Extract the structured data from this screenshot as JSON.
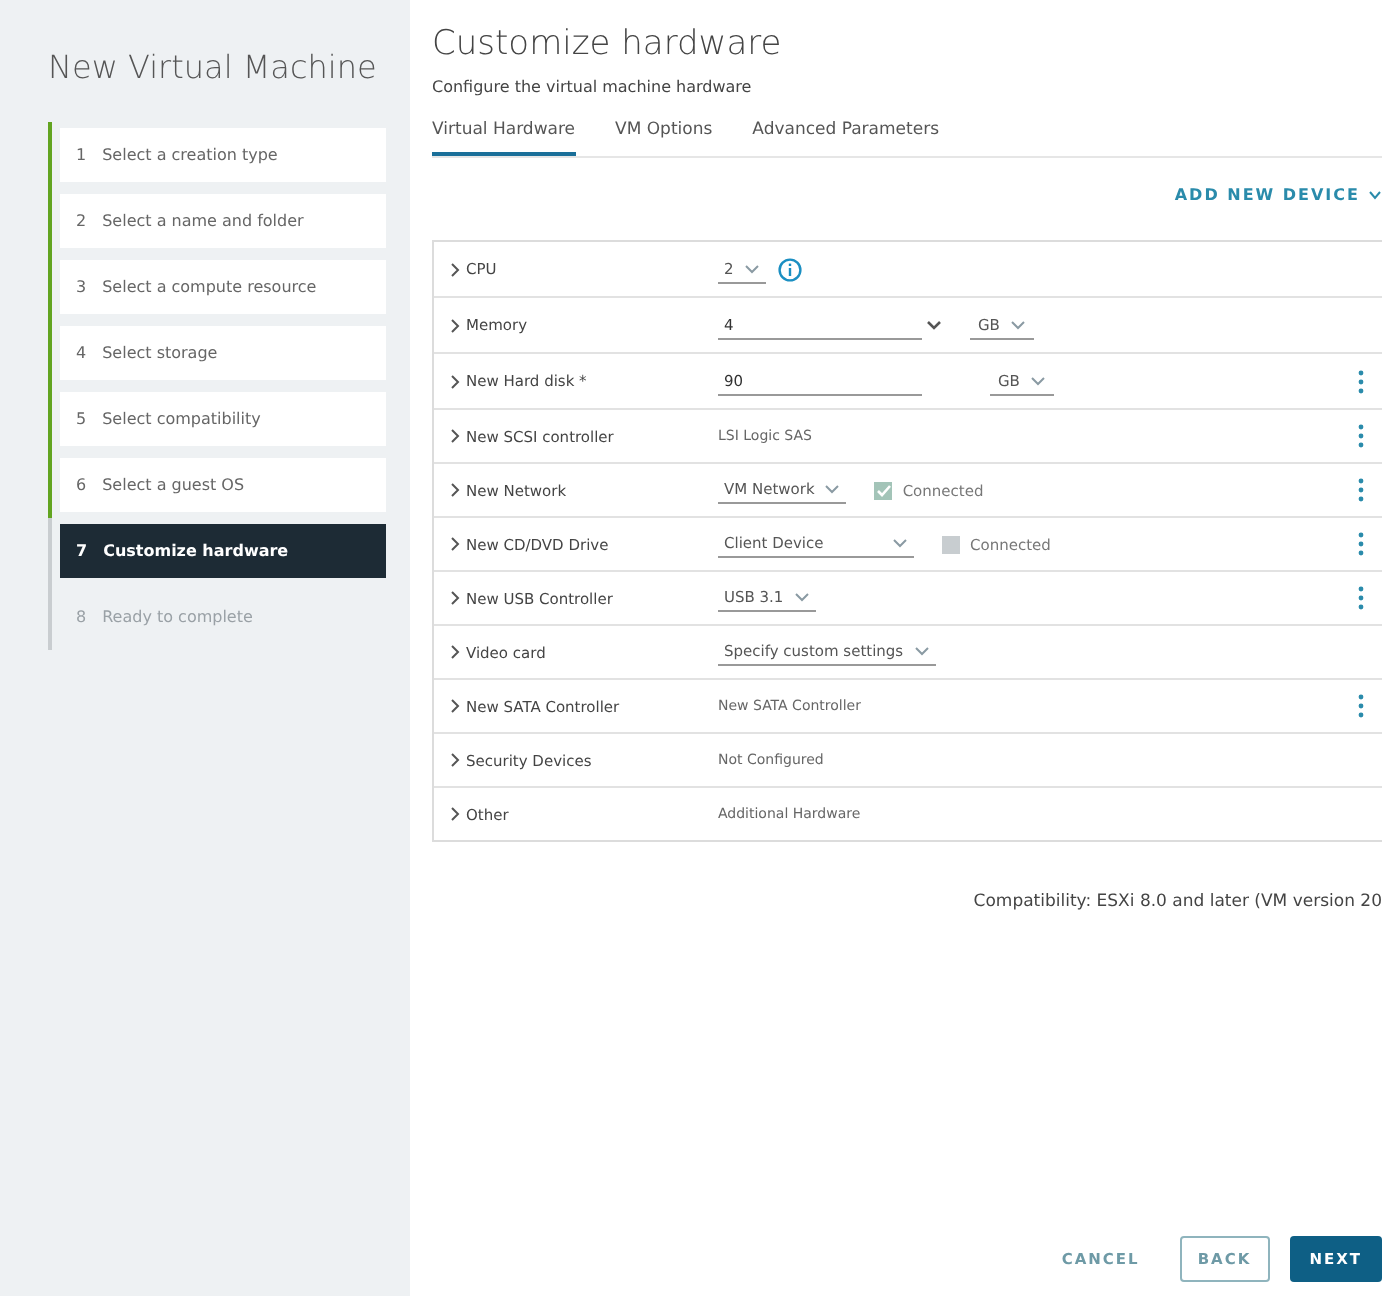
{
  "wizard": {
    "title": "New Virtual Machine",
    "steps": [
      {
        "number": "1",
        "label": "Select a creation type",
        "completed": true,
        "selected": false,
        "disabled": false
      },
      {
        "number": "2",
        "label": "Select a name and folder",
        "completed": true,
        "selected": false,
        "disabled": false
      },
      {
        "number": "3",
        "label": "Select a compute resource",
        "completed": true,
        "selected": false,
        "disabled": false
      },
      {
        "number": "4",
        "label": "Select storage",
        "completed": true,
        "selected": false,
        "disabled": false
      },
      {
        "number": "5",
        "label": "Select compatibility",
        "completed": true,
        "selected": false,
        "disabled": false
      },
      {
        "number": "6",
        "label": "Select a guest OS",
        "completed": true,
        "selected": false,
        "disabled": false
      },
      {
        "number": "7",
        "label": "Customize hardware",
        "completed": false,
        "selected": true,
        "disabled": false
      },
      {
        "number": "8",
        "label": "Ready to complete",
        "completed": false,
        "selected": false,
        "disabled": true
      }
    ]
  },
  "page": {
    "title": "Customize hardware",
    "subtitle": "Configure the virtual machine hardware"
  },
  "tabs": [
    {
      "label": "Virtual Hardware",
      "selected": true
    },
    {
      "label": "VM Options",
      "selected": false
    },
    {
      "label": "Advanced Parameters",
      "selected": false
    }
  ],
  "add_device": "ADD NEW DEVICE",
  "hardware": [
    {
      "label": "CPU",
      "kind": "select",
      "value": "2",
      "info": true
    },
    {
      "label": "Memory",
      "kind": "input",
      "value": "4",
      "unit": "GB",
      "caret": true
    },
    {
      "label": "New Hard disk *",
      "kind": "input",
      "value": "90",
      "unit": "GB",
      "menu": true
    },
    {
      "label": "New SCSI controller",
      "kind": "text",
      "value": "LSI Logic SAS",
      "menu": true
    },
    {
      "label": "New Network",
      "kind": "select",
      "value": "VM Network",
      "checkbox": {
        "label": "Connected",
        "checked": true
      },
      "menu": true
    },
    {
      "label": "New CD/DVD Drive",
      "kind": "select",
      "value": "Client Device",
      "wide": true,
      "checkbox": {
        "label": "Connected",
        "checked": false
      },
      "menu": true
    },
    {
      "label": "New USB Controller",
      "kind": "select",
      "value": "USB 3.1",
      "menu": true
    },
    {
      "label": "Video card",
      "kind": "select",
      "value": "Specify custom settings"
    },
    {
      "label": "New SATA Controller",
      "kind": "text",
      "value": "New SATA Controller",
      "menu": true
    },
    {
      "label": "Security Devices",
      "kind": "text",
      "value": "Not Configured"
    },
    {
      "label": "Other",
      "kind": "text",
      "value": "Additional Hardware"
    }
  ],
  "compatibility": "Compatibility: ESXi 8.0 and later (VM version 20",
  "buttons": [
    {
      "label": "CANCEL",
      "kind": "flat"
    },
    {
      "label": "BACK",
      "kind": "outline"
    },
    {
      "label": "NEXT",
      "kind": "primary"
    }
  ]
}
